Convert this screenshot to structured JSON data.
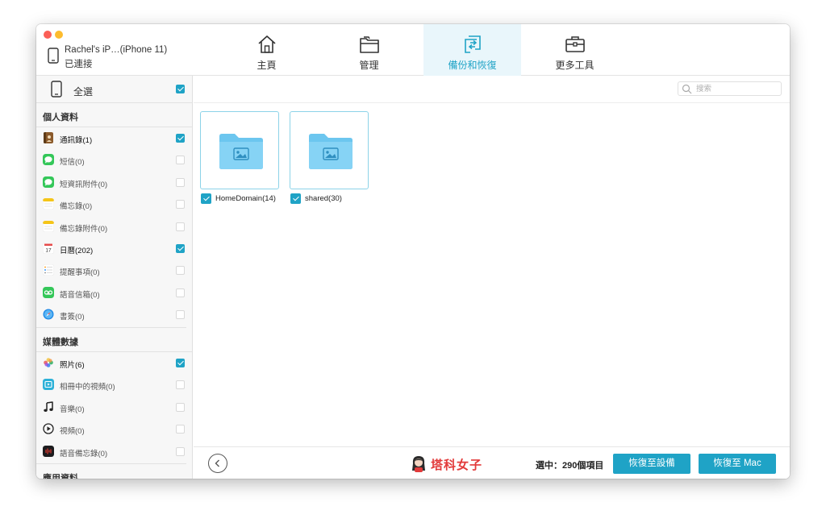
{
  "window": {
    "device_name": "Rachel's iP…(iPhone 11)",
    "device_status": "已連接"
  },
  "nav": [
    {
      "label": "主頁",
      "icon": "home-icon",
      "active": false
    },
    {
      "label": "管理",
      "icon": "folder-manage-icon",
      "active": false
    },
    {
      "label": "備份和恢復",
      "icon": "backup-restore-icon",
      "active": true
    },
    {
      "label": "更多工具",
      "icon": "toolbox-icon",
      "active": false
    }
  ],
  "sidebar": {
    "select_all_label": "全選",
    "select_all_checked": true,
    "sections": [
      {
        "title": "個人資料",
        "items": [
          {
            "label": "通訊錄(1)",
            "icon": "contacts-icon",
            "color": "#8b5a2b",
            "checked": true
          },
          {
            "label": "短信(0)",
            "icon": "messages-icon",
            "color": "#34c759",
            "checked": false
          },
          {
            "label": "短資訊附件(0)",
            "icon": "message-attachments-icon",
            "color": "#34c759",
            "checked": false
          },
          {
            "label": "備忘錄(0)",
            "icon": "notes-icon",
            "color": "#f5c518",
            "checked": false
          },
          {
            "label": "備忘錄附件(0)",
            "icon": "notes-attachments-icon",
            "color": "#f5c518",
            "checked": false
          },
          {
            "label": "日曆(202)",
            "icon": "calendar-icon",
            "color": "#e54b4b",
            "checked": true
          },
          {
            "label": "提醒事項(0)",
            "icon": "reminders-icon",
            "color": "#8e8e93",
            "checked": false
          },
          {
            "label": "語音信箱(0)",
            "icon": "voicemail-icon",
            "color": "#34c759",
            "checked": false
          },
          {
            "label": "書簽(0)",
            "icon": "safari-bookmarks-icon",
            "color": "#1e88e5",
            "checked": false
          }
        ]
      },
      {
        "title": "媒體數據",
        "items": [
          {
            "label": "照片(6)",
            "icon": "photos-icon",
            "color": "#f2994a",
            "checked": true
          },
          {
            "label": "相冊中的視頻(0)",
            "icon": "album-video-icon",
            "color": "#2db1d8",
            "checked": false
          },
          {
            "label": "音樂(0)",
            "icon": "music-icon",
            "color": "#222222",
            "checked": false
          },
          {
            "label": "視頻(0)",
            "icon": "video-icon",
            "color": "#222222",
            "checked": false
          },
          {
            "label": "語音備忘錄(0)",
            "icon": "voice-memos-icon",
            "color": "#1c1c1e",
            "checked": false
          }
        ]
      },
      {
        "title": "應用資料",
        "items": []
      }
    ]
  },
  "search": {
    "placeholder": "搜索"
  },
  "folders": [
    {
      "label": "HomeDomain(14)",
      "checked": true
    },
    {
      "label": "shared(30)",
      "checked": true
    }
  ],
  "footer": {
    "brand_text": "塔科女子",
    "selected_count": "選中：290個項目",
    "restore_to_device_label": "恢復至設備",
    "restore_to_mac_label": "恢復至 Mac"
  },
  "colors": {
    "accent": "#1fa3c6",
    "active_tab_bg": "#e9f6fb",
    "folder_blue": "#6cc6ef",
    "brand_red": "#e23a3a"
  }
}
